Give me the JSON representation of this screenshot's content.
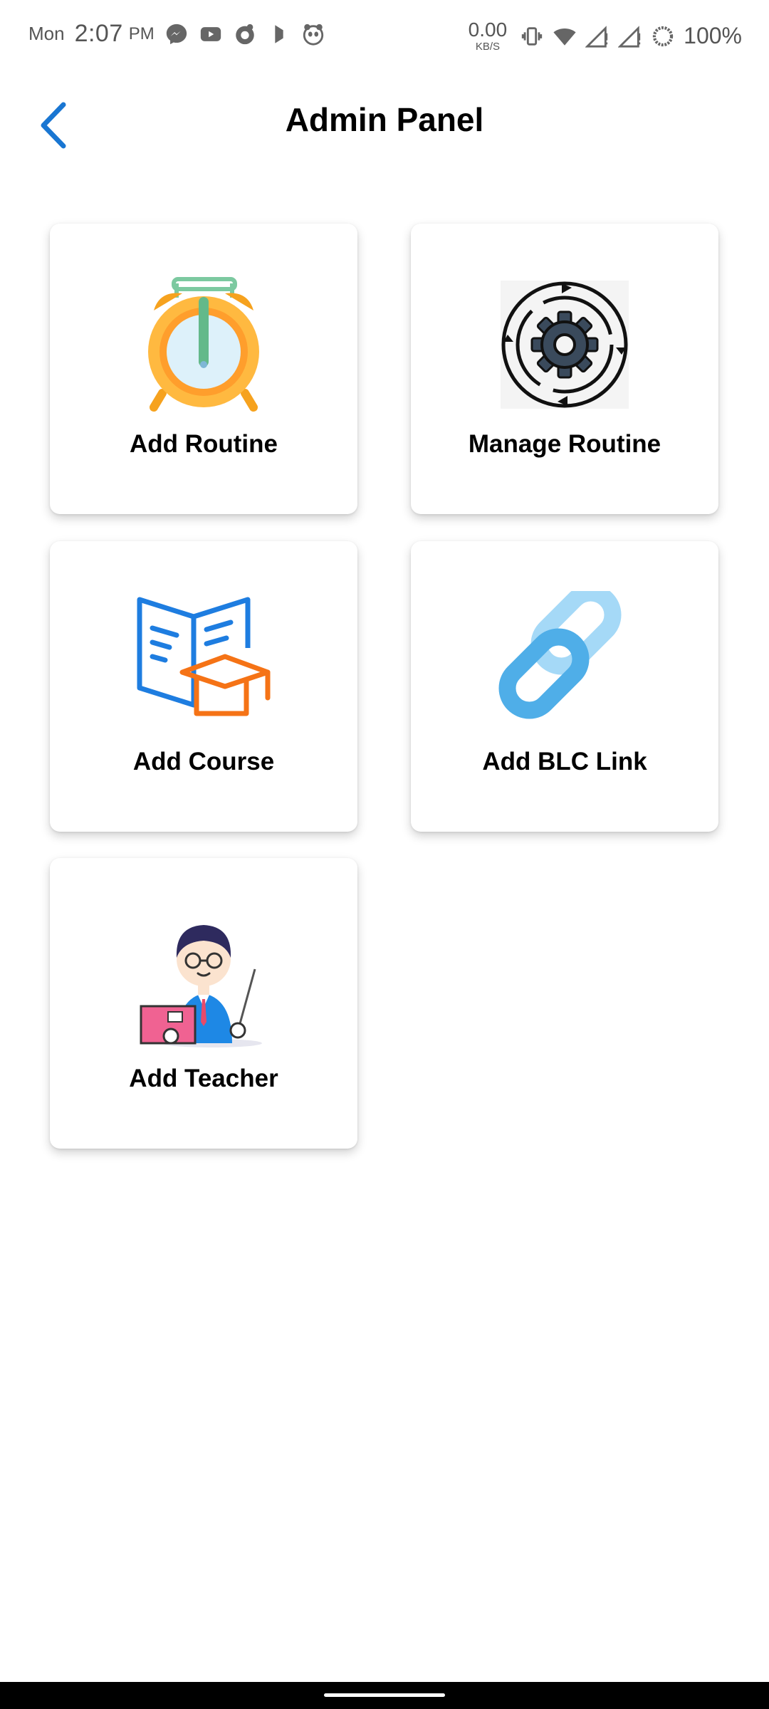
{
  "status_bar": {
    "day": "Mon",
    "time": "2:07",
    "ampm": "PM",
    "net_speed": "0.00",
    "net_unit": "KB/S",
    "battery": "100%",
    "icons": [
      "messenger-icon",
      "youtube-icon",
      "app-icon",
      "bell-app-icon",
      "panda-icon",
      "vibrate-icon",
      "wifi-icon",
      "signal-icon",
      "signal-icon",
      "battery-icon"
    ]
  },
  "header": {
    "title": "Admin Panel",
    "back_icon": "chevron-left-icon",
    "accent": "#1976D2"
  },
  "cards": [
    {
      "label": "Add Routine",
      "icon": "alarm-clock-icon"
    },
    {
      "label": "Manage Routine",
      "icon": "gear-cycle-icon"
    },
    {
      "label": "Add Course",
      "icon": "book-graduation-cap-icon"
    },
    {
      "label": "Add BLC Link",
      "icon": "link-chain-icon"
    },
    {
      "label": "Add Teacher",
      "icon": "teacher-icon"
    }
  ]
}
